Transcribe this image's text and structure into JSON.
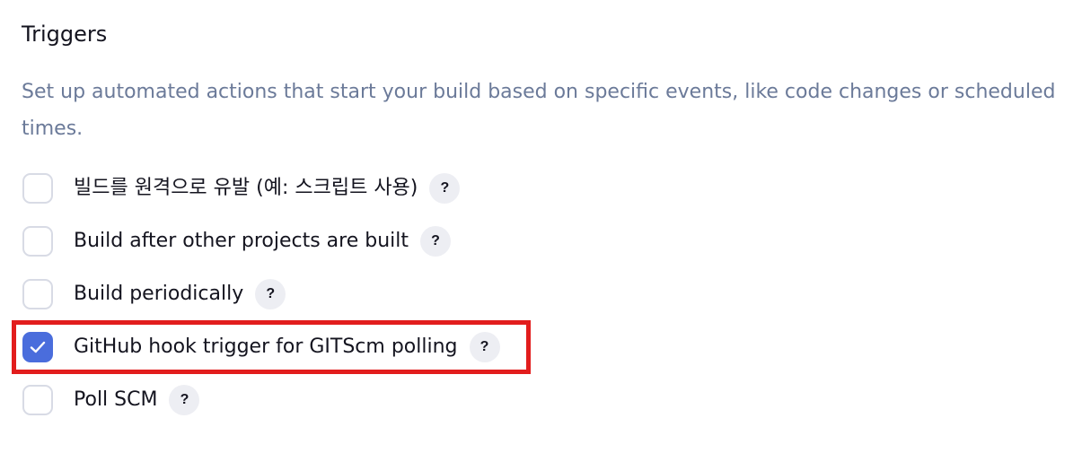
{
  "section": {
    "title": "Triggers",
    "description": "Set up automated actions that start your build based on specific events, like code changes or scheduled times."
  },
  "options": [
    {
      "label": "빌드를 원격으로 유발 (예: 스크립트 사용)",
      "checked": false,
      "help": "?"
    },
    {
      "label": "Build after other projects are built",
      "checked": false,
      "help": "?"
    },
    {
      "label": "Build periodically",
      "checked": false,
      "help": "?"
    },
    {
      "label": "GitHub hook trigger for GITScm polling",
      "checked": true,
      "help": "?"
    },
    {
      "label": "Poll SCM",
      "checked": false,
      "help": "?"
    }
  ],
  "colors": {
    "accent": "#4a6ddc",
    "description_text": "#6b7a99",
    "highlight_box": "#e21d1d",
    "help_badge": "#edeef3"
  },
  "icons": {
    "checkmark": "check-icon",
    "help": "help-icon"
  }
}
